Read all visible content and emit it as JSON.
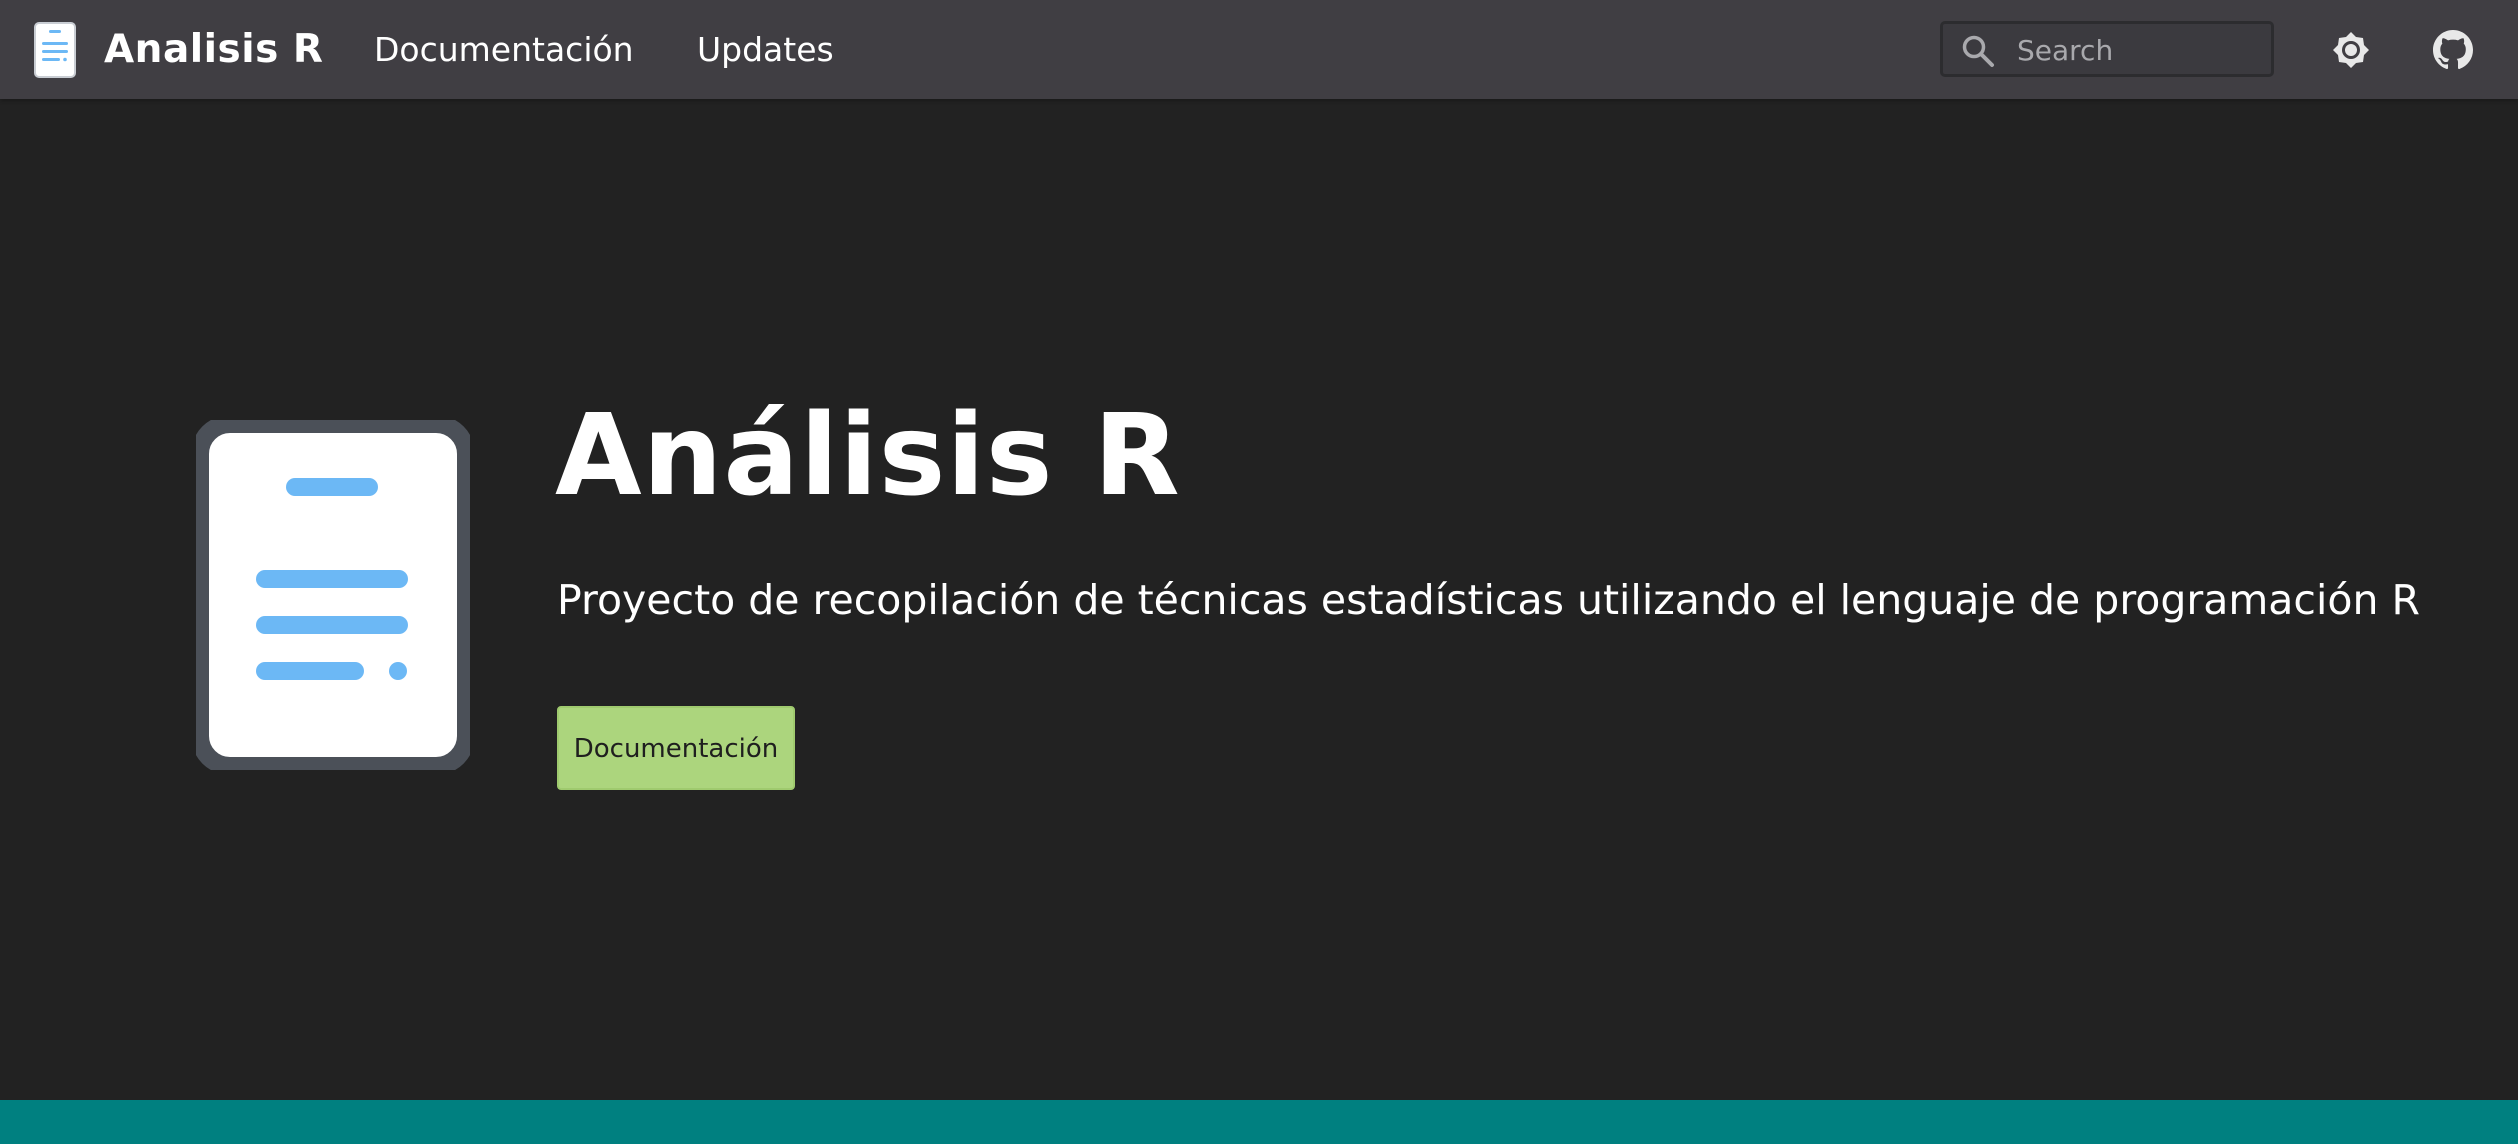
{
  "header": {
    "brand_title": "Analisis R",
    "nav": {
      "docs_label": "Documentación",
      "updates_label": "Updates"
    },
    "search": {
      "placeholder": "Search",
      "value": ""
    },
    "icons": {
      "logo": "document-icon",
      "search": "search-icon",
      "theme": "brightness-icon",
      "github": "github-icon"
    }
  },
  "hero": {
    "title": "Análisis R",
    "subtitle": "Proyecto de recopilación de técnicas estadísticas utilizando el lenguaje de programación R",
    "button_label": "Documentación",
    "logo_icon": "document-icon"
  },
  "colors": {
    "navbar": "#403e43",
    "background": "#222222",
    "accent_blue": "#6cb8f5",
    "button": "#acd57d",
    "footer": "#008080"
  }
}
